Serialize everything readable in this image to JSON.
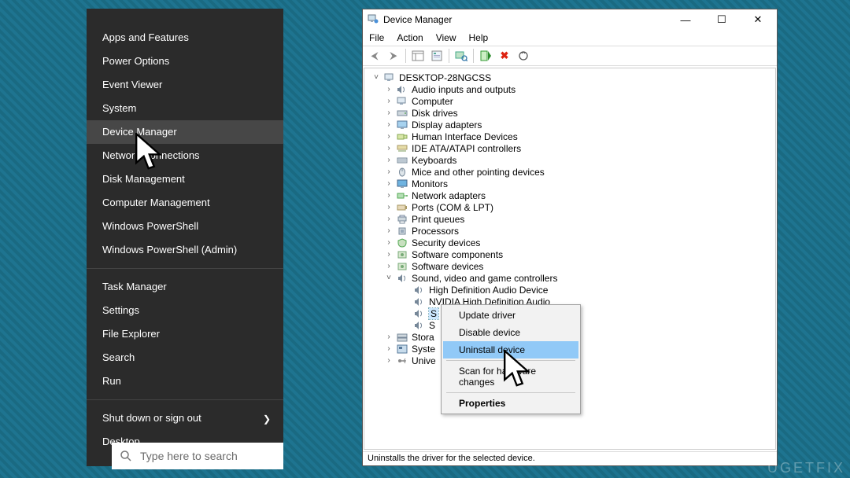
{
  "winx": {
    "items": [
      "Apps and Features",
      "Power Options",
      "Event Viewer",
      "System",
      "Device Manager",
      "Network Connections",
      "Disk Management",
      "Computer Management",
      "Windows PowerShell",
      "Windows PowerShell (Admin)"
    ],
    "group2": [
      "Task Manager",
      "Settings",
      "File Explorer",
      "Search",
      "Run"
    ],
    "group3": [
      "Shut down or sign out",
      "Desktop"
    ],
    "highlight_index": 4
  },
  "searchbar": {
    "placeholder": "Type here to search"
  },
  "dm": {
    "title": "Device Manager",
    "menus": [
      "File",
      "Action",
      "View",
      "Help"
    ],
    "root": "DESKTOP-28NGCSS",
    "categories": [
      {
        "label": "Audio inputs and outputs",
        "icon": "speaker"
      },
      {
        "label": "Computer",
        "icon": "computer"
      },
      {
        "label": "Disk drives",
        "icon": "disk"
      },
      {
        "label": "Display adapters",
        "icon": "display"
      },
      {
        "label": "Human Interface Devices",
        "icon": "hid"
      },
      {
        "label": "IDE ATA/ATAPI controllers",
        "icon": "ide"
      },
      {
        "label": "Keyboards",
        "icon": "keyboard"
      },
      {
        "label": "Mice and other pointing devices",
        "icon": "mouse"
      },
      {
        "label": "Monitors",
        "icon": "monitor"
      },
      {
        "label": "Network adapters",
        "icon": "network"
      },
      {
        "label": "Ports (COM & LPT)",
        "icon": "port"
      },
      {
        "label": "Print queues",
        "icon": "printer"
      },
      {
        "label": "Processors",
        "icon": "cpu"
      },
      {
        "label": "Security devices",
        "icon": "security"
      },
      {
        "label": "Software components",
        "icon": "component"
      },
      {
        "label": "Software devices",
        "icon": "component"
      }
    ],
    "sound_label": "Sound, video and game controllers",
    "sound_children": [
      "High Definition Audio Device",
      "NVIDIA High Definition Audio",
      "S",
      "S"
    ],
    "after": [
      {
        "label": "Stora",
        "icon": "storage"
      },
      {
        "label": "Syste",
        "icon": "system"
      },
      {
        "label": "Unive",
        "icon": "usb"
      }
    ],
    "status": "Uninstalls the driver for the selected device."
  },
  "context_menu": {
    "items": [
      {
        "label": "Update driver"
      },
      {
        "label": "Disable device"
      },
      {
        "label": "Uninstall device",
        "highlighted": true
      }
    ],
    "scan": "Scan for hardware changes",
    "props": "Properties"
  },
  "watermark": "UGETFIX"
}
